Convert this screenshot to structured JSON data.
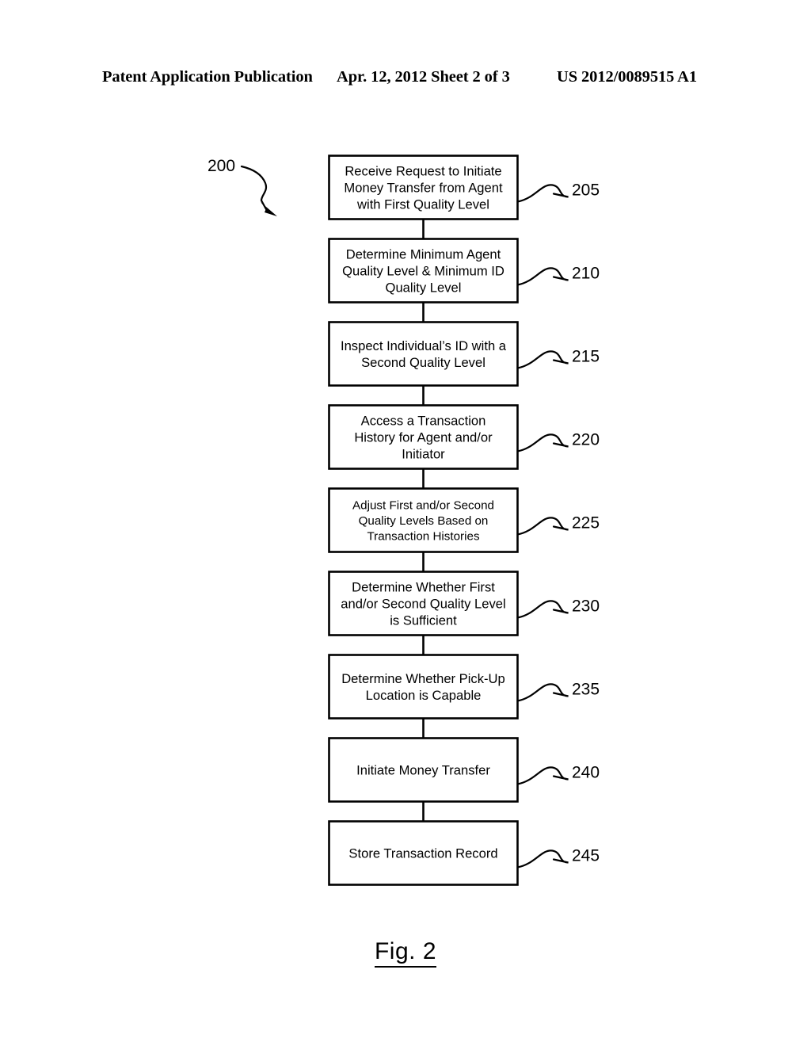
{
  "header": {
    "publication": "Patent Application Publication",
    "date_sheet": "Apr. 12, 2012  Sheet 2 of 3",
    "publication_number": "US 2012/0089515 A1"
  },
  "figure": {
    "caption": "Fig. 2",
    "diagram_label": "200"
  },
  "flowchart": {
    "type": "flowchart",
    "orientation": "vertical",
    "nodes": [
      {
        "ref": "205",
        "lines": [
          "Receive Request to Initiate",
          "Money Transfer from Agent",
          "with First Quality Level"
        ],
        "text_size": "normal"
      },
      {
        "ref": "210",
        "lines": [
          "Determine Minimum Agent",
          "Quality Level & Minimum ID",
          "Quality Level"
        ],
        "text_size": "normal"
      },
      {
        "ref": "215",
        "lines": [
          "Inspect Individual’s ID with a",
          "Second Quality Level"
        ],
        "text_size": "normal"
      },
      {
        "ref": "220",
        "lines": [
          "Access a Transaction",
          "History for Agent and/or",
          "Initiator"
        ],
        "text_size": "normal"
      },
      {
        "ref": "225",
        "lines": [
          "Adjust First and/or Second",
          "Quality Levels Based on",
          "Transaction Histories"
        ],
        "text_size": "small"
      },
      {
        "ref": "230",
        "lines": [
          "Determine Whether First",
          "and/or Second Quality Level",
          "is Sufficient"
        ],
        "text_size": "normal"
      },
      {
        "ref": "235",
        "lines": [
          "Determine Whether Pick-Up",
          "Location is Capable"
        ],
        "text_size": "normal"
      },
      {
        "ref": "240",
        "lines": [
          "Initiate Money Transfer"
        ],
        "text_size": "normal"
      },
      {
        "ref": "245",
        "lines": [
          "Store Transaction Record"
        ],
        "text_size": "normal"
      }
    ]
  }
}
